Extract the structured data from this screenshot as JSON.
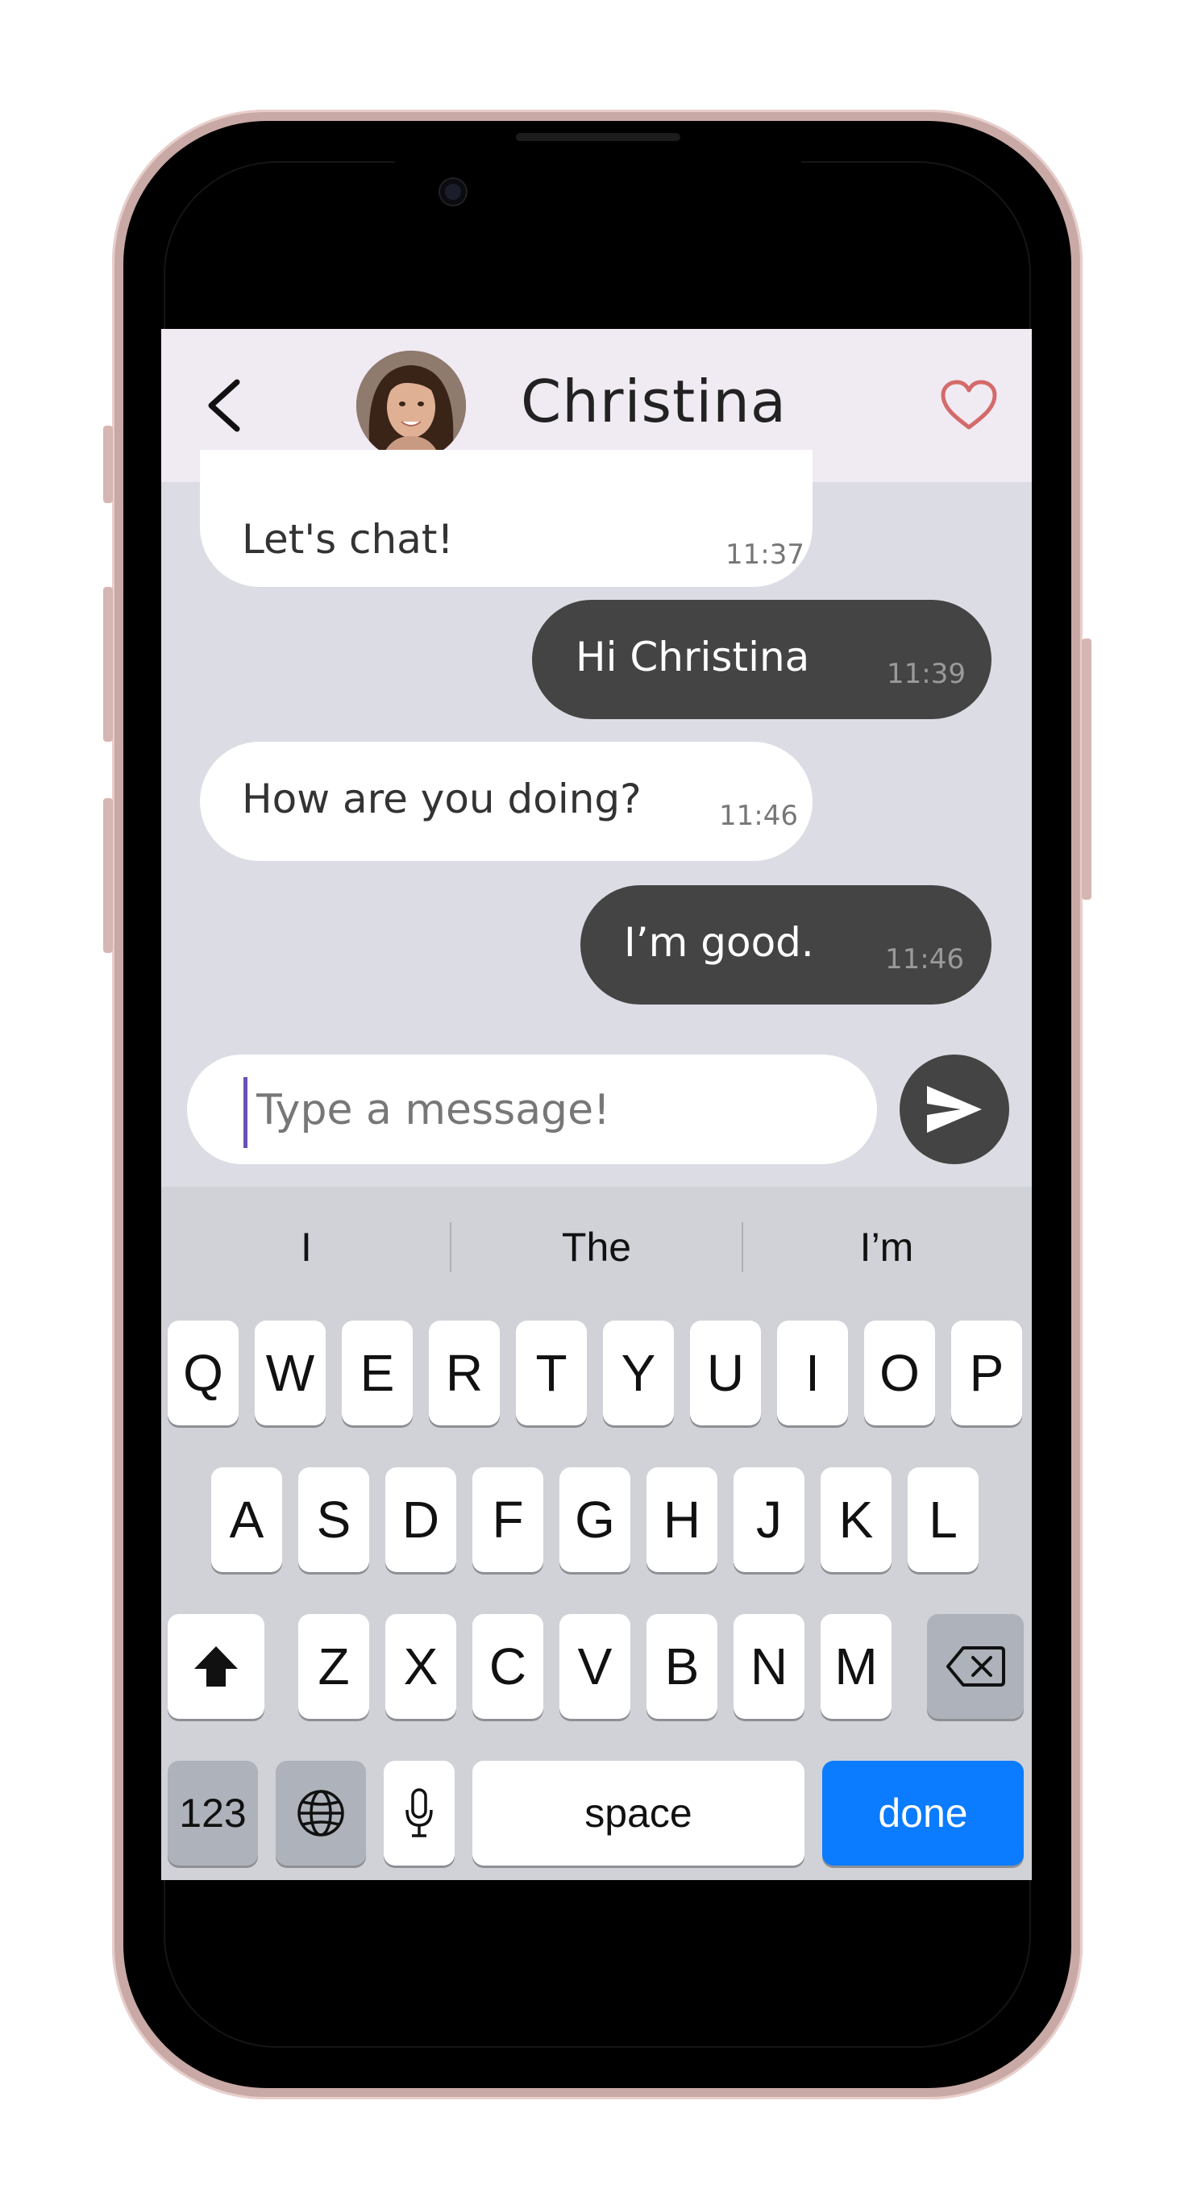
{
  "header": {
    "contact_name": "Christina"
  },
  "messages": [
    {
      "direction": "in",
      "text": "Let's chat!",
      "time": "11:37"
    },
    {
      "direction": "out",
      "text": "Hi Christina",
      "time": "11:39"
    },
    {
      "direction": "in",
      "text": "How are you doing?",
      "time": "11:46"
    },
    {
      "direction": "out",
      "text": "I’m good.",
      "time": "11:46"
    }
  ],
  "composer": {
    "placeholder": "Type a message!"
  },
  "keyboard": {
    "suggestions": [
      "I",
      "The",
      "I’m"
    ],
    "row1": [
      "Q",
      "W",
      "E",
      "R",
      "T",
      "Y",
      "U",
      "I",
      "O",
      "P"
    ],
    "row2": [
      "A",
      "S",
      "D",
      "F",
      "G",
      "H",
      "J",
      "K",
      "L"
    ],
    "row3": [
      "Z",
      "X",
      "C",
      "V",
      "B",
      "N",
      "M"
    ],
    "numbers_key": "123",
    "space_key": "space",
    "done_key": "done"
  },
  "colors": {
    "header_bg": "#f0eaf3",
    "chat_bg": "#dcdce5",
    "outgoing_bubble": "#444444",
    "incoming_bubble": "#ffffff",
    "heart": "#d46a6a",
    "done_key": "#0b7bff"
  },
  "icons": [
    "back-chevron-icon",
    "heart-icon",
    "send-icon",
    "shift-icon",
    "backspace-icon",
    "globe-icon",
    "microphone-icon"
  ]
}
